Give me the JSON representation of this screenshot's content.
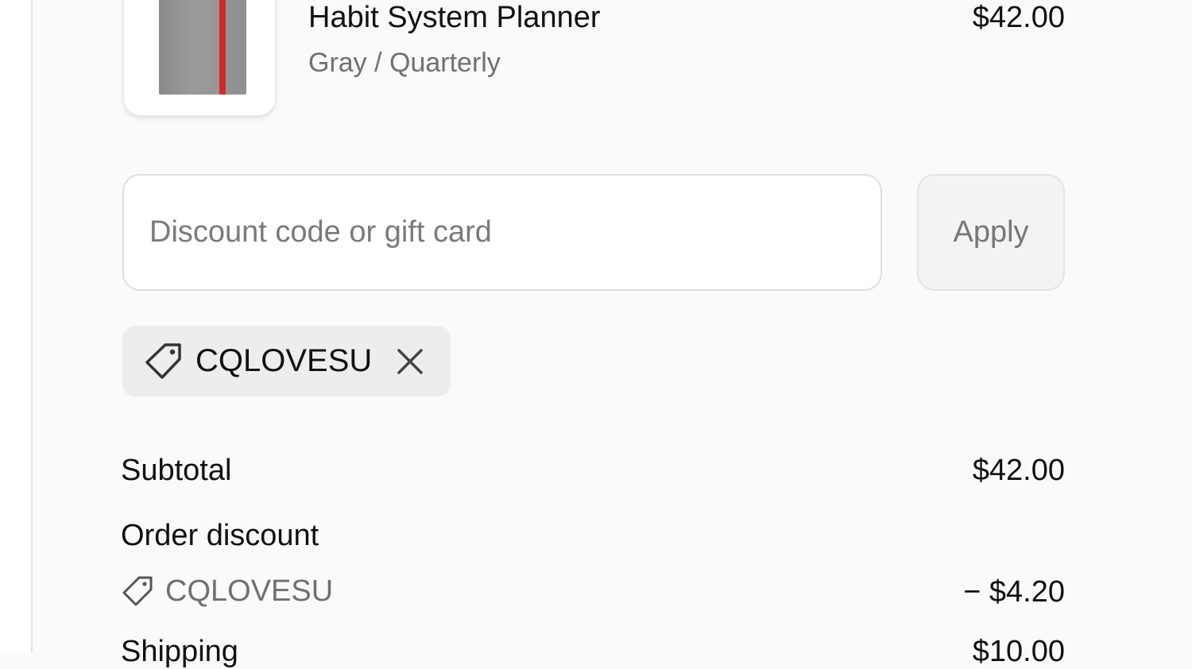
{
  "product": {
    "name": "Habit System Planner",
    "variant": "Gray / Quarterly",
    "price": "$42.00",
    "thumbnail": "planner-image",
    "colors": {
      "cover": "#8f8f8f",
      "band": "#d22a2a"
    }
  },
  "discount": {
    "placeholder": "Discount code or gift card",
    "value": "",
    "apply_label": "Apply",
    "applied_code": "CQLOVESU",
    "tag_icon": "tag-icon",
    "remove_icon": "close-icon"
  },
  "summary": {
    "subtotal_label": "Subtotal",
    "subtotal_value": "$42.00",
    "order_discount_label": "Order discount",
    "order_discount_code": "CQLOVESU",
    "order_discount_value": "− $4.20",
    "shipping_label": "Shipping",
    "shipping_value": "$10.00"
  }
}
